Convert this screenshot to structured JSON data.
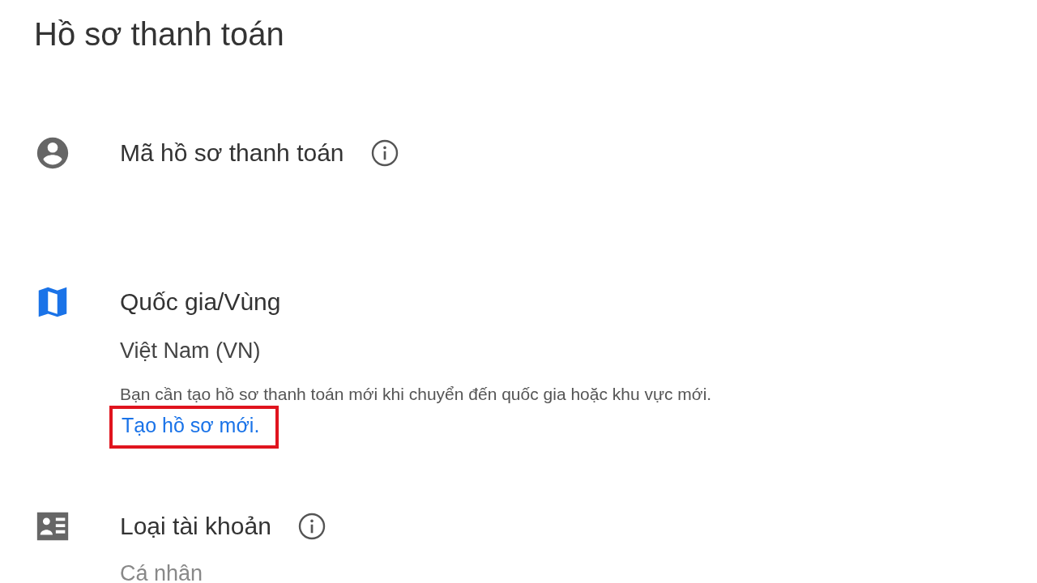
{
  "title": "Hồ sơ thanh toán",
  "sections": [
    {
      "kind": "id",
      "label": "Mã hồ sơ thanh toán",
      "info": true
    },
    {
      "kind": "country",
      "label": "Quốc gia/Vùng",
      "info": false,
      "value": "Việt Nam (VN)",
      "note": "Bạn cần tạo hồ sơ thanh toán mới khi chuyển đến quốc gia hoặc khu vực mới.",
      "link": {
        "label": "Tạo hồ sơ mới.",
        "highlighted": true
      }
    },
    {
      "kind": "account",
      "label": "Loại tài khoản",
      "info": true,
      "value": "Cá nhân"
    }
  ]
}
